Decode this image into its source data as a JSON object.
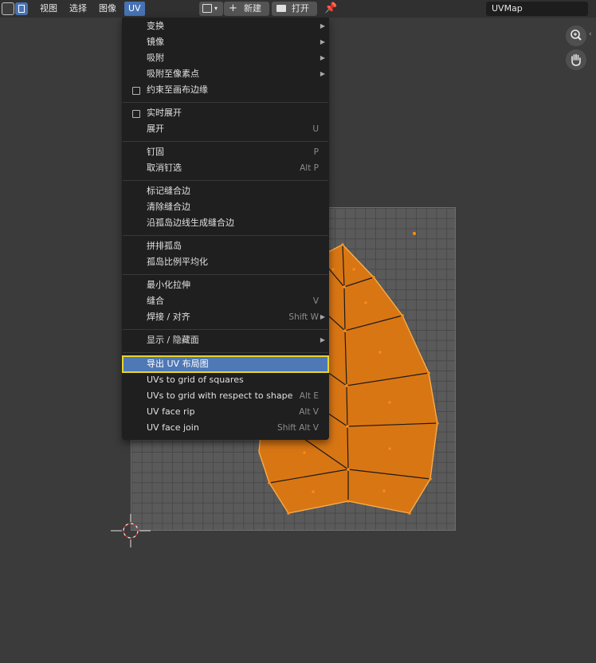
{
  "header": {
    "menus": [
      "视图",
      "选择",
      "图像",
      "UV"
    ],
    "new_label": "新建",
    "open_label": "打开",
    "uvmap_value": "UVMap"
  },
  "menu": {
    "items": [
      {
        "label": "变换",
        "shortcut": "",
        "submenu": true,
        "checkbox": false
      },
      {
        "label": "镜像",
        "shortcut": "",
        "submenu": true,
        "checkbox": false
      },
      {
        "label": "吸附",
        "shortcut": "",
        "submenu": true,
        "checkbox": false
      },
      {
        "label": "吸附至像素点",
        "shortcut": "",
        "submenu": true,
        "checkbox": false
      },
      {
        "label": "约束至画布边缘",
        "shortcut": "",
        "submenu": false,
        "checkbox": true
      },
      {
        "label": "实时展开",
        "shortcut": "",
        "submenu": false,
        "checkbox": true
      },
      {
        "label": "展开",
        "shortcut": "U",
        "submenu": false,
        "checkbox": false
      },
      {
        "label": "钉固",
        "shortcut": "P",
        "submenu": false,
        "checkbox": false
      },
      {
        "label": "取消钉选",
        "shortcut": "Alt P",
        "submenu": false,
        "checkbox": false
      },
      {
        "label": "标记缝合边",
        "shortcut": "",
        "submenu": false,
        "checkbox": false
      },
      {
        "label": "清除缝合边",
        "shortcut": "",
        "submenu": false,
        "checkbox": false
      },
      {
        "label": "沿孤岛边线生成缝合边",
        "shortcut": "",
        "submenu": false,
        "checkbox": false
      },
      {
        "label": "拼排孤岛",
        "shortcut": "",
        "submenu": false,
        "checkbox": false
      },
      {
        "label": "孤岛比例平均化",
        "shortcut": "",
        "submenu": false,
        "checkbox": false
      },
      {
        "label": "最小化拉伸",
        "shortcut": "",
        "submenu": false,
        "checkbox": false
      },
      {
        "label": "缝合",
        "shortcut": "V",
        "submenu": false,
        "checkbox": false
      },
      {
        "label": "焊接 / 对齐",
        "shortcut": "Shift W",
        "submenu": true,
        "checkbox": false
      },
      {
        "label": "显示 / 隐藏面",
        "shortcut": "",
        "submenu": true,
        "checkbox": false
      },
      {
        "label": "导出 UV 布局图",
        "shortcut": "",
        "submenu": false,
        "checkbox": false
      },
      {
        "label": "UVs to grid of squares",
        "shortcut": "",
        "submenu": false,
        "checkbox": false
      },
      {
        "label": "UVs to grid with respect to shape",
        "shortcut": "Alt E",
        "submenu": false,
        "checkbox": false
      },
      {
        "label": "UV face rip",
        "shortcut": "Alt V",
        "submenu": false,
        "checkbox": false
      },
      {
        "label": "UV face join",
        "shortcut": "Shift Alt V",
        "submenu": false,
        "checkbox": false
      }
    ]
  },
  "icons": {
    "new": "plus-icon",
    "open": "folder-icon",
    "pin": "pin-icon",
    "zoom": "zoom-icon",
    "hand": "hand-icon",
    "cursor": "2d-cursor-icon"
  },
  "colors": {
    "uv_fill": "#e07b1a",
    "uv_edge": "#ffad3a",
    "highlight": "#4e78b6",
    "highlight_border": "#e9d52a"
  }
}
